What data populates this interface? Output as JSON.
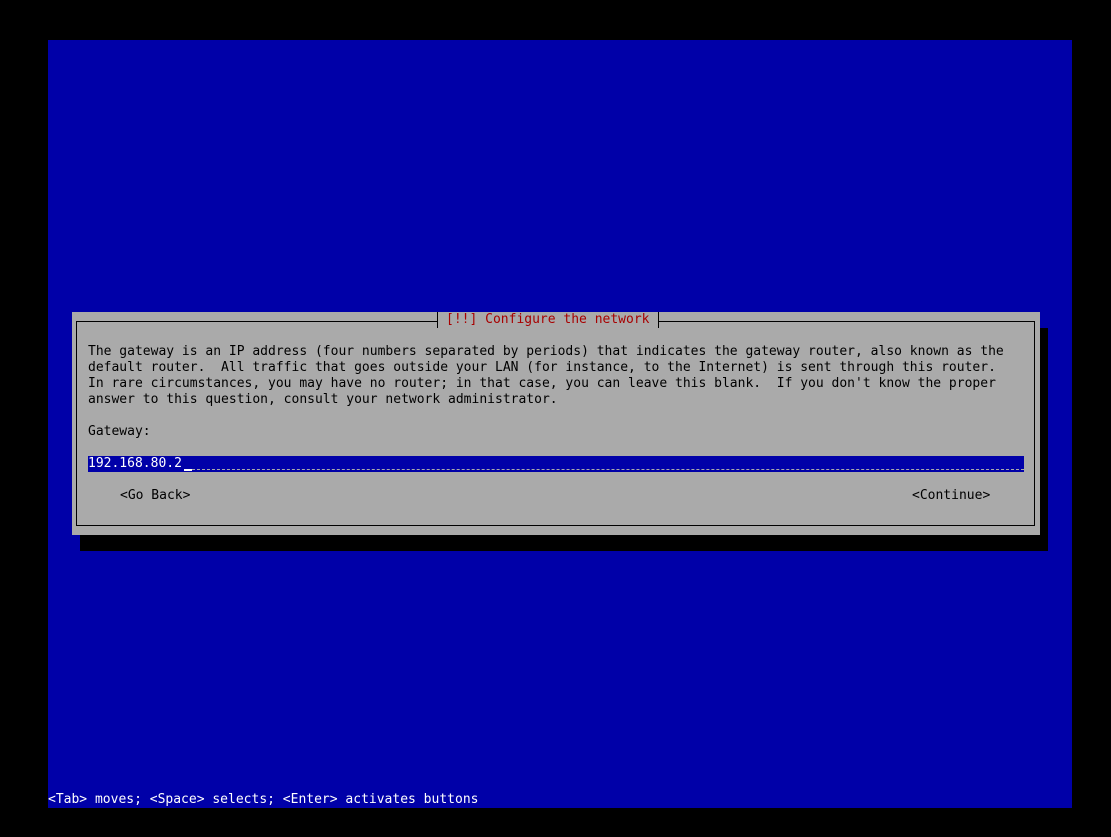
{
  "dialog": {
    "title": "[!!] Configure the network",
    "description_lines": [
      "The gateway is an IP address (four numbers separated by periods) that indicates the gateway router, also known as the",
      "default router.  All traffic that goes outside your LAN (for instance, to the Internet) is sent through this router.",
      "In rare circumstances, you may have no router; in that case, you can leave this blank.  If you don't know the proper",
      "answer to this question, consult your network administrator."
    ],
    "field_label": "Gateway:",
    "field_value": "192.168.80.2",
    "go_back_label": "<Go Back>",
    "continue_label": "<Continue>"
  },
  "footer": {
    "help_text": "<Tab> moves; <Space> selects; <Enter> activates buttons"
  },
  "colors": {
    "screen_background": "#0000a8",
    "dialog_background": "#aaaaaa",
    "title_color": "#a80000",
    "input_background": "#0000a8",
    "input_text": "#ffffff"
  }
}
